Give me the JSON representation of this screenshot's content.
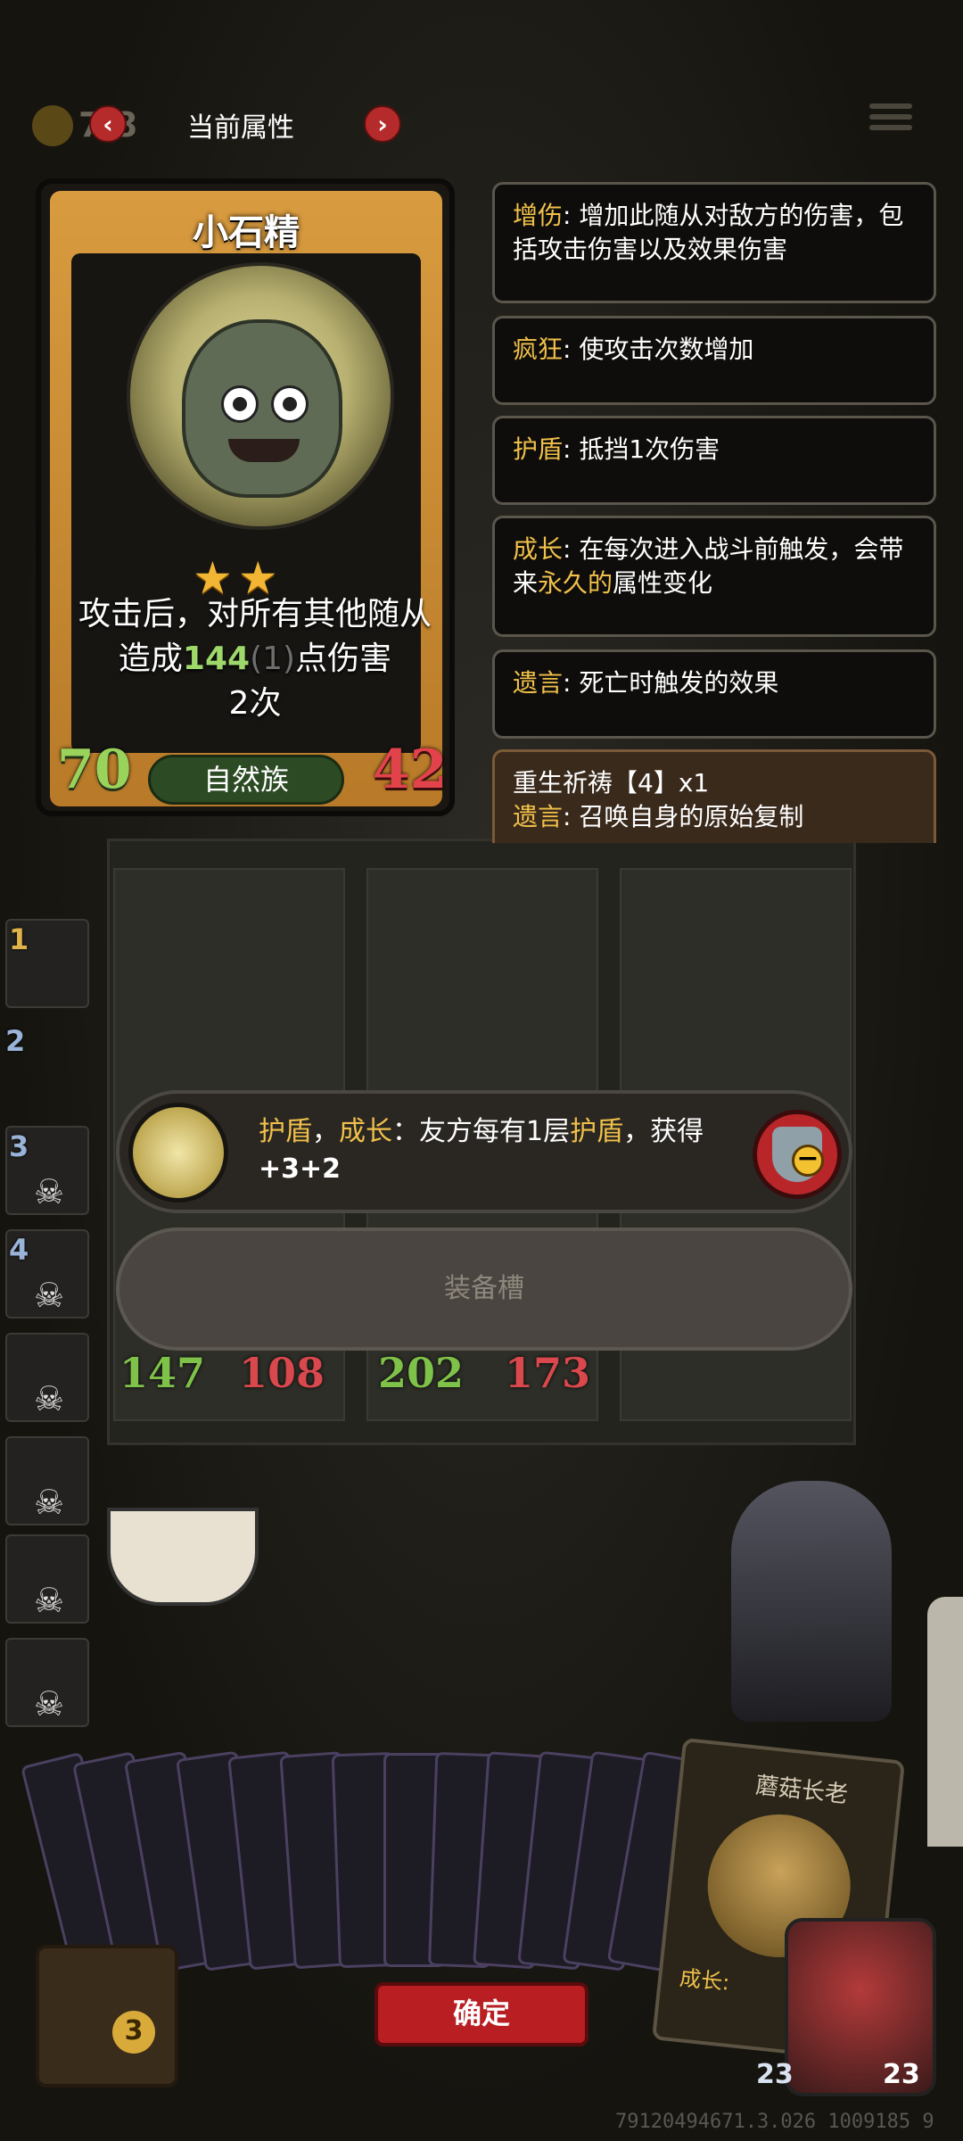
{
  "top_bar": {
    "coin_value": "7  8",
    "title": "当前属性",
    "prev_label": "‹",
    "next_label": "›"
  },
  "card": {
    "name": "小石精",
    "stars": "★★",
    "desc_prefix": "攻击后，对所有其他随从造成",
    "desc_number": "144",
    "desc_extra": "(1)",
    "desc_suffix": "点伤害",
    "desc_line3": "2次",
    "attack": "70",
    "health": "42",
    "tribe": "自然族"
  },
  "keywords": [
    {
      "name": "增伤",
      "text": ": 增加此随从对敌方的伤害，包括攻击伤害以及效果伤害"
    },
    {
      "name": "疯狂",
      "text": ": 使攻击次数增加"
    },
    {
      "name": "护盾",
      "text": ": 抵挡1次伤害"
    },
    {
      "name": "成长",
      "text_a": ": 在每次进入战斗前触发，会带来",
      "highlight": "永久的",
      "text_b": "属性变化"
    },
    {
      "name": "遗言",
      "text": ": 死亡时触发的效果"
    }
  ],
  "special": {
    "title": "重生祈祷【4】x1",
    "kw": "遗言",
    "text": ": 召唤自身的原始复制"
  },
  "side_list": {
    "nums": [
      "1",
      "2",
      "3",
      "4"
    ]
  },
  "board_stats": {
    "left_atk": "147",
    "left_hp": "108",
    "right_atk": "202",
    "right_hp": "173"
  },
  "equipment": {
    "kw1": "护盾",
    "sep": "，",
    "kw2": "成长",
    "text_a": "：友方每有1层",
    "kw3": "护盾",
    "text_b": "，获得",
    "bonus": "+3+2",
    "slot_label": "装备槽"
  },
  "hand": {
    "big_card_name": "蘑菇长老",
    "big_card_kw": "成长:",
    "confirm_label": "确定",
    "chest_count": "3",
    "hero_attack": "23",
    "hero_health": "23"
  },
  "footer": {
    "version": "79120494671.3.026 1009185 9"
  },
  "colors": {
    "keyword": "#f0c04a",
    "attack": "#9ad35c",
    "health": "#e2434a",
    "button_red": "#b81e22"
  }
}
